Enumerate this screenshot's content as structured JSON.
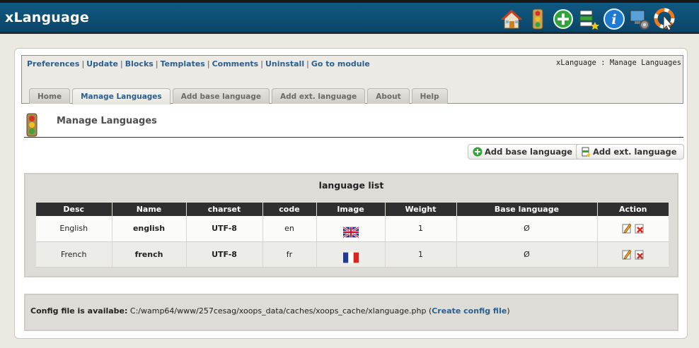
{
  "app": {
    "title": "xLanguage"
  },
  "toolbar": {
    "icons": [
      "home-icon",
      "traffic-light-icon",
      "add-icon",
      "blocks-icon",
      "info-icon",
      "system-icon",
      "help-cursor-icon"
    ]
  },
  "admin_menu": {
    "links": [
      "Preferences",
      "Update",
      "Blocks",
      "Templates",
      "Comments",
      "Uninstall",
      "Go to module"
    ],
    "separator": "|",
    "breadcrumb": "xLanguage : Manage Languages"
  },
  "tabs": [
    {
      "label": "Home",
      "active": false
    },
    {
      "label": "Manage Languages",
      "active": true
    },
    {
      "label": "Add base language",
      "active": false
    },
    {
      "label": "Add ext. language",
      "active": false
    },
    {
      "label": "About",
      "active": false
    },
    {
      "label": "Help",
      "active": false
    }
  ],
  "page": {
    "title": "Manage Languages"
  },
  "buttons": {
    "add_base": "Add base language",
    "add_ext": "Add ext. language"
  },
  "language_list": {
    "title": "language list",
    "columns": [
      "Desc",
      "Name",
      "charset",
      "code",
      "Image",
      "Weight",
      "Base language",
      "Action"
    ],
    "rows": [
      {
        "desc": "English",
        "name": "english",
        "charset": "UTF-8",
        "code": "en",
        "image": "uk-flag",
        "weight": "1",
        "base": "Ø"
      },
      {
        "desc": "French",
        "name": "french",
        "charset": "UTF-8",
        "code": "fr",
        "image": "fr-flag",
        "weight": "1",
        "base": "Ø"
      }
    ]
  },
  "config": {
    "label": "Config file is availabe:",
    "path": "C:/wamp64/www/257cesag/xoops_data/caches/xoops_cache/xlanguage.php",
    "open_paren": "(",
    "link": "Create config file",
    "close_paren": ")"
  },
  "colors": {
    "header": "#0a4567",
    "link": "#2b5f8f",
    "table_header": "#2f2f2f"
  }
}
